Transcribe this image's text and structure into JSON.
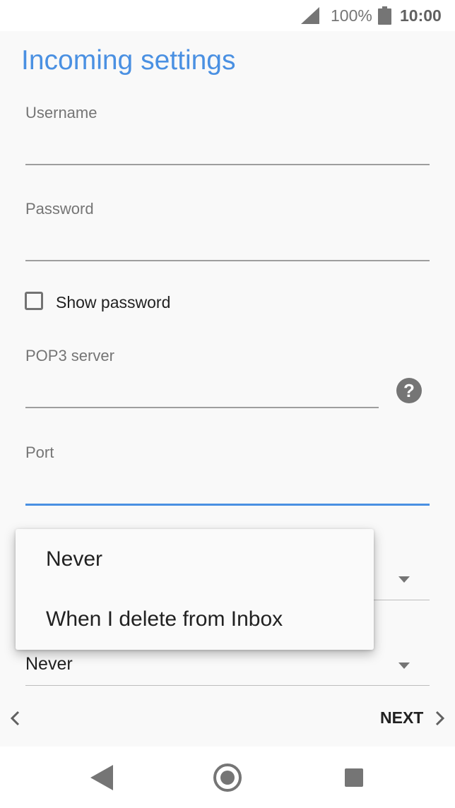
{
  "status_bar": {
    "battery_percent": "100%",
    "time": "10:00"
  },
  "page": {
    "title": "Incoming settings"
  },
  "fields": {
    "username_label": "Username",
    "username_value": "",
    "password_label": "Password",
    "password_value": "",
    "show_password_label": "Show password",
    "show_password_checked": false,
    "pop3_server_label": "POP3 server",
    "pop3_server_value": "",
    "port_label": "Port",
    "port_value": ""
  },
  "delete_from_server": {
    "selected_value": "Never"
  },
  "popup_menu": {
    "items": [
      "Never",
      "When I delete from Inbox"
    ]
  },
  "footer": {
    "next_label": "NEXT"
  },
  "colors": {
    "accent": "#4a90e2",
    "background": "#f9f9f9",
    "icon_gray": "#757575"
  },
  "icons": {
    "signal": "signal-icon",
    "battery": "battery-icon",
    "help": "help-icon",
    "back": "chevron-left-icon",
    "next": "chevron-right-icon",
    "nav_back": "triangle-back-icon",
    "nav_home": "circle-home-icon",
    "nav_recents": "square-recents-icon"
  }
}
